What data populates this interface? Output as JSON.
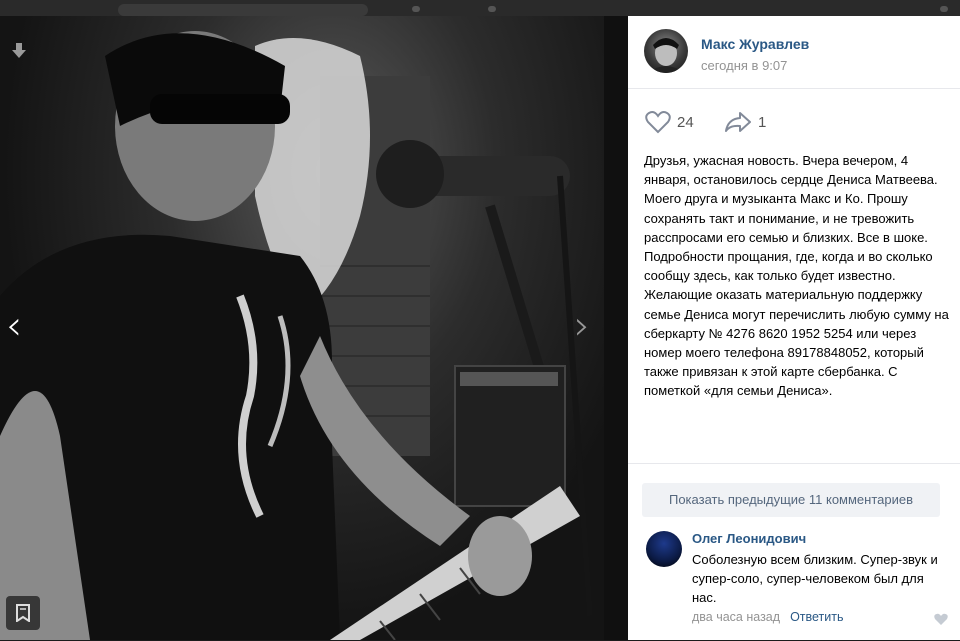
{
  "post": {
    "author_name": "Макс Журавлев",
    "timestamp": "сегодня в 9:07",
    "likes": "24",
    "shares": "1",
    "text": "Друзья, ужасная новость. Вчера вечером, 4 января, остановилось сердце Дениса Матвеева. Моего друга и музыканта Макс и Ко. Прошу сохранять такт и понимание, и не тревожить расспросами его семью и близких. Все в шоке. Подробности прощания, где, когда и во сколько сообщу здесь, как только будет известно.\nЖелающие оказать материальную поддержку семье Дениса могут перечислить любую сумму на сберкарту № 4276 8620 1952 5254 или через номер моего телефона 89178848052, который также привязан к этой карте сбербанка. С пометкой «для семьи Дениса»."
  },
  "comments": {
    "show_previous_label": "Показать предыдущие 11 комментариев",
    "items": [
      {
        "author": "Олег Леонидович",
        "text": "Соболезную всем близким. Супер-звук и супер-соло, супер-человеком был для нас.",
        "time": "два часа назад",
        "reply_label": "Ответить"
      }
    ]
  },
  "icons": {
    "nav_prev": "‹",
    "nav_next": "›",
    "download": "download-icon",
    "bookmark": "bookmark-icon",
    "like": "heart-icon",
    "share": "share-arrow-icon"
  },
  "colors": {
    "link": "#2a5885",
    "muted": "#939393",
    "viewer_bg": "#0e0e0e"
  }
}
